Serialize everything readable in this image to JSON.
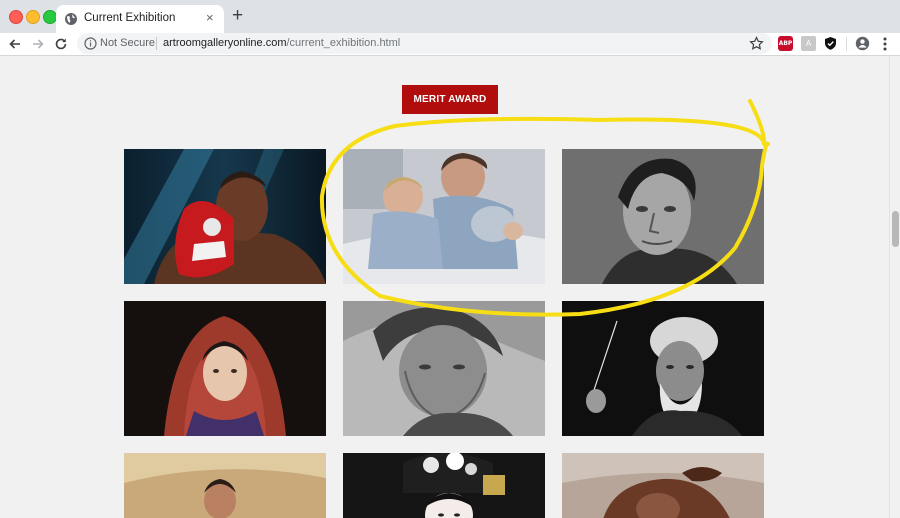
{
  "browser": {
    "tab": {
      "title": "Current Exhibition",
      "close_glyph": "×"
    },
    "new_tab_glyph": "+",
    "omnibox": {
      "security_label": "Not Secure",
      "url_host": "artroomgalleryonline.com",
      "url_path": "/current_exhibition.html"
    },
    "extensions": {
      "abp_label": "ABP",
      "grey_label": "A"
    },
    "icons": [
      "back-icon",
      "forward-icon",
      "reload-icon",
      "info-icon",
      "star-icon",
      "adblock-icon",
      "extension-icon",
      "shield-icon",
      "profile-icon",
      "menu-icon",
      "globe-icon"
    ],
    "colors": {
      "tabstrip": "#dee1e6",
      "omnibox": "#f1f3f4"
    }
  },
  "page": {
    "award_label": "MERIT AWARD",
    "accent_color": "#b10d0d",
    "annotation_color": "#f7dd14",
    "artworks": [
      {
        "subject": "boxer with red glove"
      },
      {
        "subject": "mother holding children in hospital bed"
      },
      {
        "subject": "charcoal portrait of a man"
      },
      {
        "subject": "girl with red hood"
      },
      {
        "subject": "elderly woman portrait"
      },
      {
        "subject": "old man conducting"
      },
      {
        "subject": "child on golden background"
      },
      {
        "subject": "geisha with hair ornaments"
      },
      {
        "subject": "figure with dark hair"
      }
    ]
  }
}
